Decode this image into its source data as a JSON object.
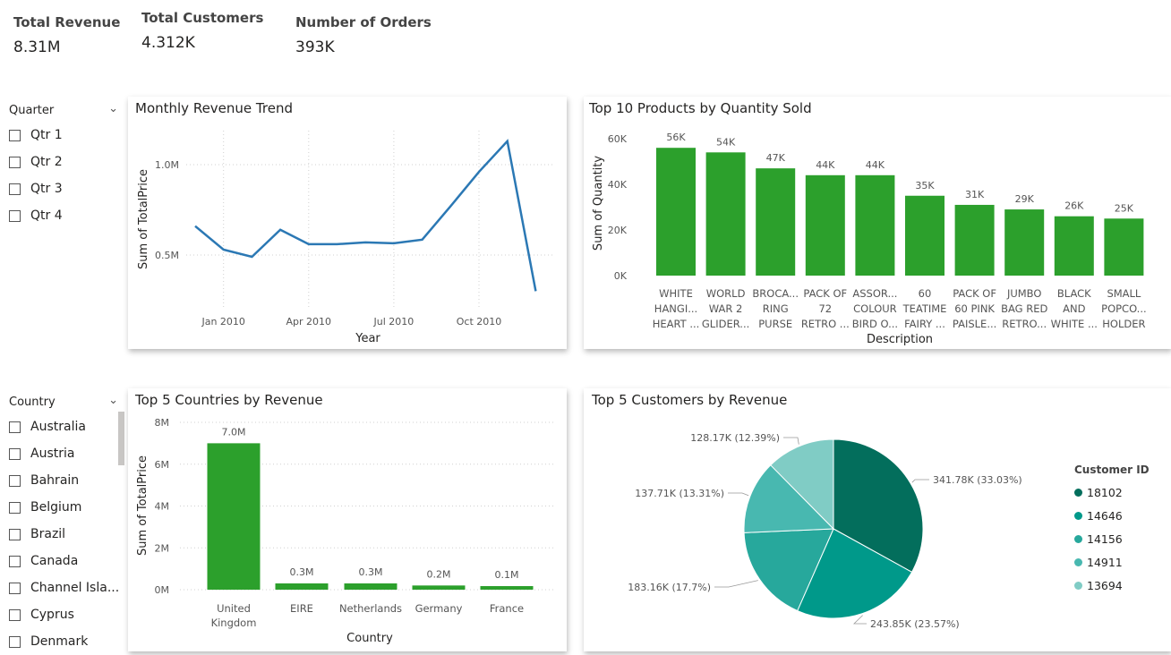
{
  "kpis": {
    "revenue": {
      "label": "Total Revenue",
      "value": "8.31M"
    },
    "customers": {
      "label": "Total Customers",
      "value": "4.312K"
    },
    "orders": {
      "label": "Number of Orders",
      "value": "393K"
    }
  },
  "quarter_slicer": {
    "title": "Quarter",
    "items": [
      "Qtr 1",
      "Qtr 2",
      "Qtr 3",
      "Qtr 4"
    ]
  },
  "country_slicer": {
    "title": "Country",
    "items": [
      "Australia",
      "Austria",
      "Bahrain",
      "Belgium",
      "Brazil",
      "Canada",
      "Channel Isla...",
      "Cyprus",
      "Denmark"
    ]
  },
  "colors": {
    "line": "#2b78b4",
    "bar": "#2ca02c",
    "pie": [
      "#036e5c",
      "#00998a",
      "#27a89c",
      "#48b8b0",
      "#80ccc5"
    ]
  },
  "chart_data": [
    {
      "type": "line",
      "title": "Monthly Revenue Trend",
      "xlabel": "Year",
      "ylabel": "Sum of TotalPrice",
      "x": [
        "2009-12",
        "2010-01",
        "2010-02",
        "2010-03",
        "2010-04",
        "2010-05",
        "2010-06",
        "2010-07",
        "2010-08",
        "2010-09",
        "2010-10",
        "2010-11",
        "2010-12"
      ],
      "values": [
        0.66,
        0.53,
        0.49,
        0.64,
        0.56,
        0.56,
        0.57,
        0.565,
        0.585,
        0.77,
        0.96,
        1.13,
        0.3
      ],
      "xticks": [
        "Jan 2010",
        "Apr 2010",
        "Jul 2010",
        "Oct 2010"
      ],
      "yticks": [
        "0.5M",
        "1.0M"
      ],
      "unit": "M"
    },
    {
      "type": "bar",
      "title": "Top 10 Products by Quantity Sold",
      "xlabel": "Description",
      "ylabel": "Sum of Quantity",
      "categories": [
        [
          "WHITE",
          "HANGI...",
          "HEART ..."
        ],
        [
          "WORLD",
          "WAR 2",
          "GLIDER..."
        ],
        [
          "BROCA...",
          "RING",
          "PURSE"
        ],
        [
          "PACK OF",
          "72",
          "RETRO ..."
        ],
        [
          "ASSOR...",
          "COLOUR",
          "BIRD O..."
        ],
        [
          "60",
          "TEATIME",
          "FAIRY ..."
        ],
        [
          "PACK OF",
          "60 PINK",
          "PAISLE..."
        ],
        [
          "JUMBO",
          "BAG RED",
          "RETRO..."
        ],
        [
          "BLACK",
          "AND",
          "WHITE ..."
        ],
        [
          "SMALL",
          "POPCO...",
          "HOLDER"
        ]
      ],
      "values": [
        56,
        54,
        47,
        44,
        44,
        35,
        31,
        29,
        26,
        25
      ],
      "data_labels": [
        "56K",
        "54K",
        "47K",
        "44K",
        "44K",
        "35K",
        "31K",
        "29K",
        "26K",
        "25K"
      ],
      "yticks": [
        "0K",
        "20K",
        "40K",
        "60K"
      ],
      "ylim": [
        0,
        60
      ],
      "unit": "K"
    },
    {
      "type": "bar",
      "title": "Top 5 Countries by Revenue",
      "xlabel": "Country",
      "ylabel": "Sum of TotalPrice",
      "categories": [
        [
          "United",
          "Kingdom"
        ],
        [
          "EIRE"
        ],
        [
          "Netherlands"
        ],
        [
          "Germany"
        ],
        [
          "France"
        ]
      ],
      "values": [
        7.0,
        0.3,
        0.3,
        0.2,
        0.1
      ],
      "data_labels": [
        "7.0M",
        "0.3M",
        "0.3M",
        "0.2M",
        "0.1M"
      ],
      "yticks": [
        "0M",
        "2M",
        "4M",
        "6M",
        "8M"
      ],
      "ylim": [
        0,
        8
      ],
      "unit": "M"
    },
    {
      "type": "pie",
      "title": "Top 5 Customers by Revenue",
      "legend_title": "Customer ID",
      "labels": [
        "18102",
        "14646",
        "14156",
        "14911",
        "13694"
      ],
      "values": [
        341.78,
        243.85,
        183.16,
        137.71,
        128.17
      ],
      "data_labels": [
        "341.78K (33.03%)",
        "243.85K (23.57%)",
        "183.16K (17.7%)",
        "137.71K (13.31%)",
        "128.17K (12.39%)"
      ]
    }
  ]
}
